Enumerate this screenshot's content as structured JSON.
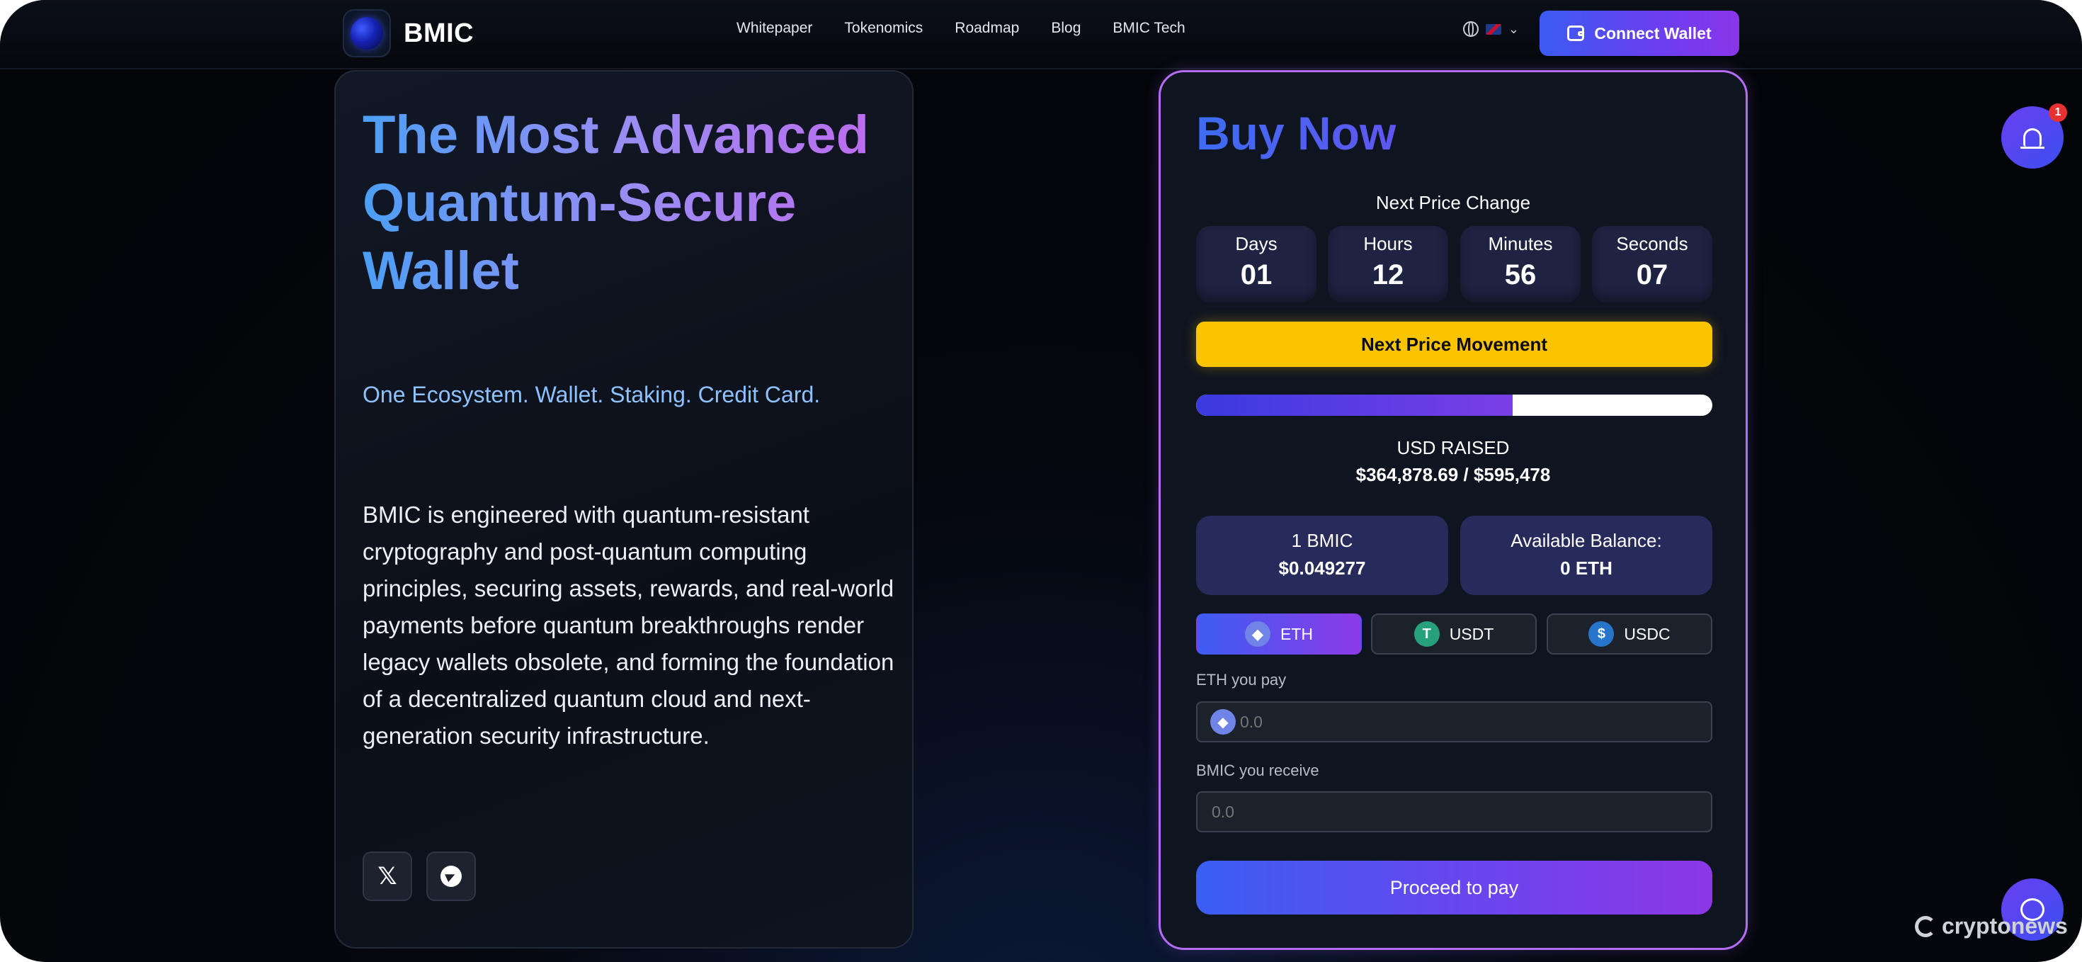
{
  "brand": {
    "name": "BMIC"
  },
  "nav": {
    "items": [
      "Whitepaper",
      "Tokenomics",
      "Roadmap",
      "Blog",
      "BMIC Tech"
    ]
  },
  "header": {
    "connect_label": "Connect Wallet",
    "language_icon": "globe-icon",
    "flag_icon": "uk-flag-icon"
  },
  "hero": {
    "headline": "The Most Advanced Quantum-Secure Wallet",
    "tagline": "One Ecosystem. Wallet. Staking. Credit Card.",
    "description": "BMIC is engineered with quantum-resistant cryptography and post-quantum computing principles, securing assets, rewards, and real-world payments before quantum breakthroughs render legacy wallets obsolete, and forming the foundation of a decentralized quantum cloud and next-generation security infrastructure.",
    "social": [
      {
        "name": "x-icon"
      },
      {
        "name": "telegram-icon"
      }
    ]
  },
  "buy": {
    "title": "Buy Now",
    "next_price_change_label": "Next Price Change",
    "countdown": [
      {
        "label": "Days",
        "value": "01"
      },
      {
        "label": "Hours",
        "value": "12"
      },
      {
        "label": "Minutes",
        "value": "56"
      },
      {
        "label": "Seconds",
        "value": "07"
      }
    ],
    "next_price_movement_label": "Next Price Movement",
    "progress_fraction": 0.613,
    "usd_raised_label": "USD RAISED",
    "usd_raised_value": "$364,878.69 / $595,478",
    "price_label": "1 BMIC",
    "price_value": "$0.049277",
    "balance_label": "Available Balance:",
    "balance_value": "0 ETH",
    "tokens": [
      {
        "label": "ETH",
        "icon": "eth-icon",
        "glyph": "◆",
        "active": true
      },
      {
        "label": "USDT",
        "icon": "usdt-icon",
        "glyph": "T",
        "active": false
      },
      {
        "label": "USDC",
        "icon": "usdc-icon",
        "glyph": "$",
        "active": false
      }
    ],
    "pay_label": "ETH you pay",
    "pay_placeholder": "0.0",
    "receive_label": "BMIC you receive",
    "receive_placeholder": "0.0",
    "proceed_label": "Proceed to pay"
  },
  "notifications": {
    "count": "1"
  },
  "watermark": "cryptonews",
  "colors": {
    "accent_blue": "#3b5bf2",
    "accent_purple": "#8a35e8",
    "highlight_yellow": "#fbc400",
    "card_border": "#b36cf2"
  }
}
